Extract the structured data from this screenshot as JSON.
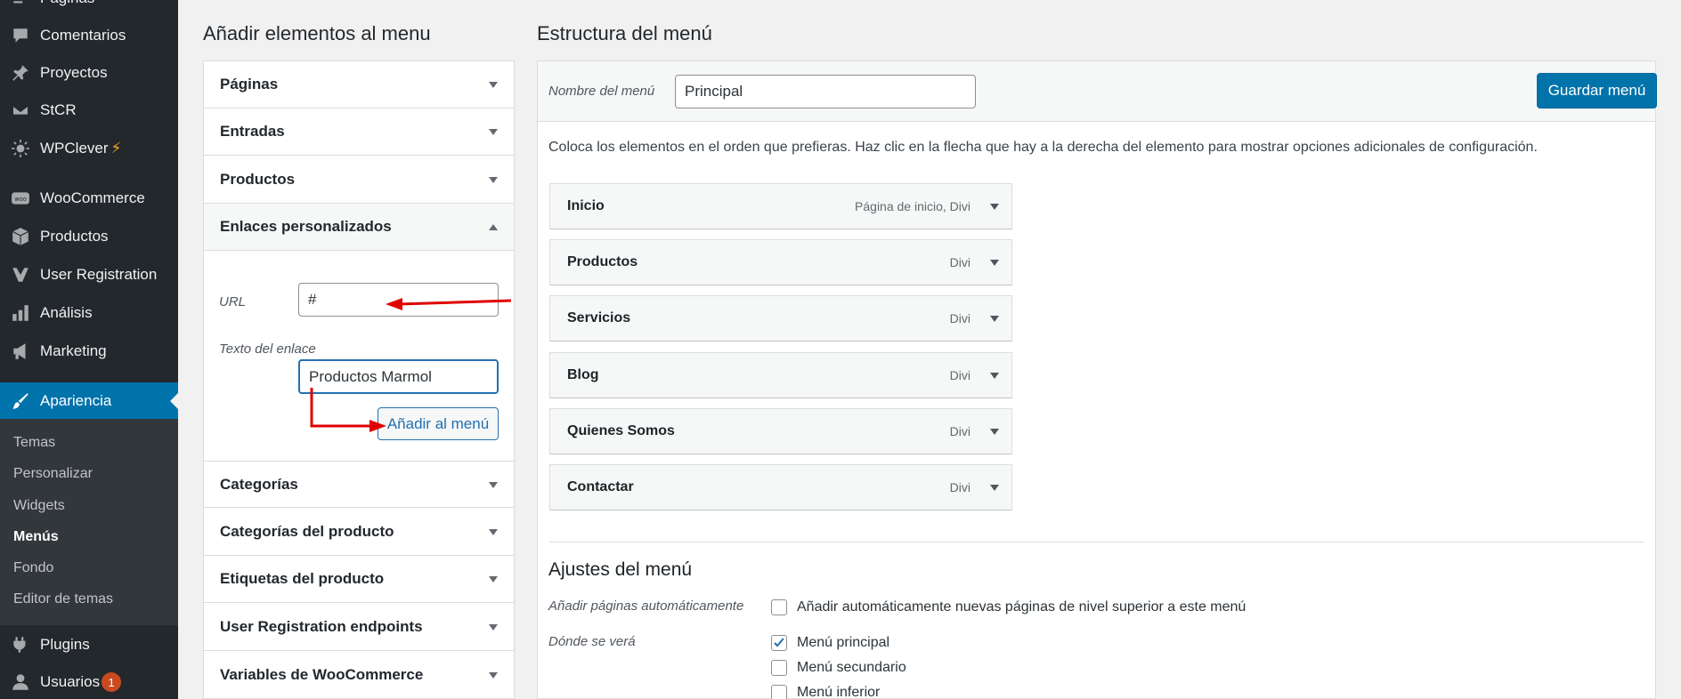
{
  "sidebar": {
    "items": [
      {
        "label": "Páginas",
        "icon": "pages-icon"
      },
      {
        "label": "Comentarios",
        "icon": "comment-icon"
      },
      {
        "label": "Proyectos",
        "icon": "pin-icon"
      },
      {
        "label": "StCR",
        "icon": "envelope-icon"
      },
      {
        "label": "WPClever",
        "icon": "sun-icon",
        "suffix": "⚡"
      },
      {
        "label": "WooCommerce",
        "icon": "woo-icon"
      },
      {
        "label": "Productos",
        "icon": "box-icon"
      },
      {
        "label": "User Registration",
        "icon": "user-registration-icon"
      },
      {
        "label": "Análisis",
        "icon": "bar-chart-icon"
      },
      {
        "label": "Marketing",
        "icon": "megaphone-icon"
      },
      {
        "label": "Apariencia",
        "icon": "paintbrush-icon",
        "active": true
      },
      {
        "label": "Plugins",
        "icon": "plug-icon"
      },
      {
        "label": "Usuarios",
        "icon": "user-icon",
        "badge": "1"
      }
    ],
    "submenu": [
      "Temas",
      "Personalizar",
      "Widgets",
      "Menús",
      "Fondo",
      "Editor de temas"
    ],
    "current_submenu": "Menús"
  },
  "left": {
    "title": "Añadir elementos al menu",
    "sections": [
      "Páginas",
      "Entradas",
      "Productos",
      "Enlaces personalizados",
      "Categorías",
      "Categorías del producto",
      "Etiquetas del producto",
      "User Registration endpoints",
      "Variables de WooCommerce"
    ],
    "custom_links": {
      "url_label": "URL",
      "url_value": "#",
      "text_label": "Texto del enlace",
      "text_value": "Productos Marmol",
      "add_button": "Añadir al menú"
    }
  },
  "right": {
    "title": "Estructura del menú",
    "name_label": "Nombre del menú",
    "name_value": "Principal",
    "save_button": "Guardar menú",
    "instructions": "Coloca los elementos en el orden que prefieras. Haz clic en la flecha que hay a la derecha del elemento para mostrar opciones adicionales de configuración.",
    "menu_items": [
      {
        "title": "Inicio",
        "type": "Página de inicio, Divi"
      },
      {
        "title": "Productos",
        "type": "Divi"
      },
      {
        "title": "Servicios",
        "type": "Divi"
      },
      {
        "title": "Blog",
        "type": "Divi"
      },
      {
        "title": "Quienes Somos",
        "type": "Divi"
      },
      {
        "title": "Contactar",
        "type": "Divi"
      }
    ],
    "settings": {
      "title": "Ajustes del menú",
      "auto_add_label": "Añadir páginas automáticamente",
      "auto_add_text": "Añadir automáticamente nuevas páginas de nivel superior a este menú",
      "auto_add_checked": false,
      "location_label": "Dónde se verá",
      "locations": [
        {
          "label": "Menú principal",
          "checked": true
        },
        {
          "label": "Menú secundario",
          "checked": false
        },
        {
          "label": "Menú inferior",
          "checked": false
        }
      ]
    }
  },
  "colors": {
    "sidebar": "#23282d",
    "active": "#0073aa",
    "annotation": "#e00000"
  }
}
